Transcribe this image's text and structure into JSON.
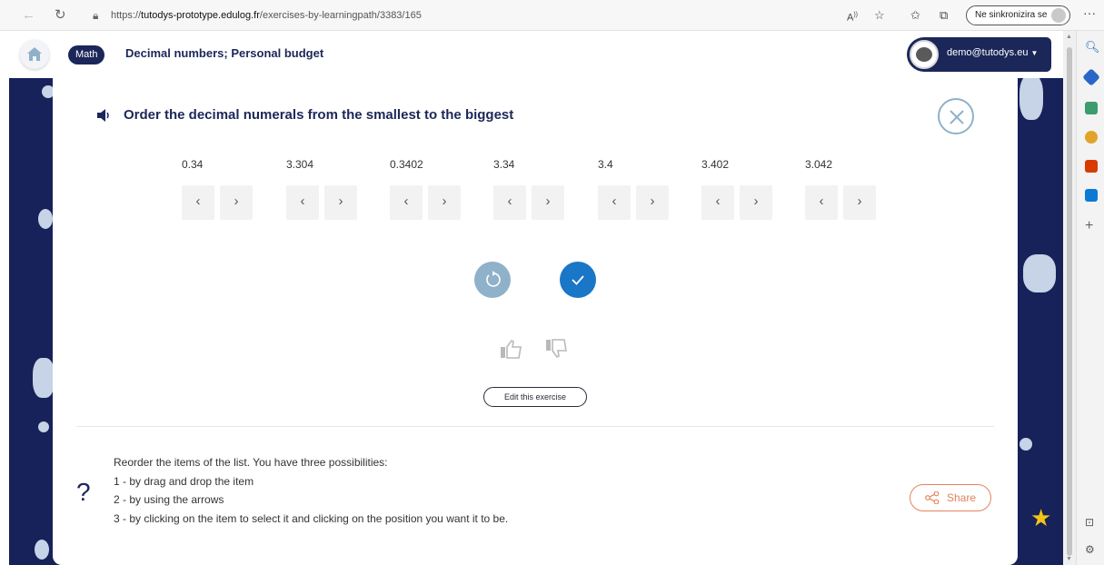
{
  "browser": {
    "url_prefix": "https://",
    "url_host": "tutodys-prototype.edulog.fr",
    "url_path": "/exercises-by-learningpath/3383/165",
    "sync_label": "Ne sinkronizira se"
  },
  "header": {
    "subject": "Math",
    "title": "Decimal numbers; Personal budget",
    "user_email": "demo@tutodys.eu"
  },
  "exercise": {
    "instruction": "Order the decimal numerals from the smallest to the biggest",
    "items": [
      "0.34",
      "3.304",
      "0.3402",
      "3.34",
      "3.4",
      "3.402",
      "3.042"
    ],
    "edit_label": "Edit this exercise"
  },
  "help": {
    "mark": "?",
    "lines": [
      "Reorder the items of the list. You have three possibilities:",
      "1 - by drag and drop the item",
      "2 - by using the arrows",
      "3 - by clicking on the item to select it and clicking on the position you want it to be."
    ],
    "share_label": "Share"
  },
  "colors": {
    "navy": "#1c2759",
    "check_blue": "#1a76c7",
    "reset_blue": "#8fb1c9",
    "share_orange": "#e4825e",
    "star_yellow": "#f3c413"
  }
}
